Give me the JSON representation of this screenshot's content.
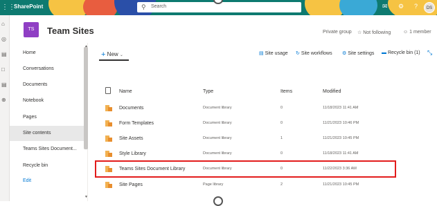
{
  "suite_bar": {
    "app_name": "SharePoint",
    "search_placeholder": "Search",
    "avatar_initials": "DS",
    "bg_color": "#0e7a70"
  },
  "site": {
    "logo_initials": "TS",
    "title": "Team Sites",
    "privacy": "Private group",
    "follow_label": "Not following",
    "members_label": "1 member"
  },
  "leftnav": {
    "items": [
      {
        "label": "Home"
      },
      {
        "label": "Conversations"
      },
      {
        "label": "Documents"
      },
      {
        "label": "Notebook"
      },
      {
        "label": "Pages"
      },
      {
        "label": "Site contents"
      },
      {
        "label": "Teams Sites Document..."
      },
      {
        "label": "Recycle bin"
      }
    ],
    "selected": "Site contents",
    "edit_label": "Edit"
  },
  "command_bar": {
    "new_label": "New",
    "site_usage": "Site usage",
    "site_workflows": "Site workflows",
    "site_settings": "Site settings",
    "recycle_bin": "Recycle bin (1)"
  },
  "table": {
    "headers": {
      "name": "Name",
      "type": "Type",
      "items": "Items",
      "modified": "Modified"
    },
    "rows": [
      {
        "name": "Documents",
        "type": "Document library",
        "items": "0",
        "modified": "11/18/2023 11:41 AM"
      },
      {
        "name": "Form Templates",
        "type": "Document library",
        "items": "0",
        "modified": "11/21/2023 10:46 PM"
      },
      {
        "name": "Site Assets",
        "type": "Document library",
        "items": "1",
        "modified": "11/21/2023 10:45 PM"
      },
      {
        "name": "Style Library",
        "type": "Document library",
        "items": "0",
        "modified": "11/18/2023 11:41 AM"
      },
      {
        "name": "Teams Sites Document Library",
        "type": "Document library",
        "items": "0",
        "modified": "11/22/2023 3:36 AM"
      },
      {
        "name": "Site Pages",
        "type": "Page library",
        "items": "2",
        "modified": "11/21/2023 10:45 PM"
      }
    ],
    "highlighted_row": "Teams Sites Document Library",
    "highlight_color": "#e21b1b"
  },
  "colors": {
    "accent": "#0078d4",
    "site_logo": "#8f3fc4",
    "folder_icon": "#f2b252"
  }
}
